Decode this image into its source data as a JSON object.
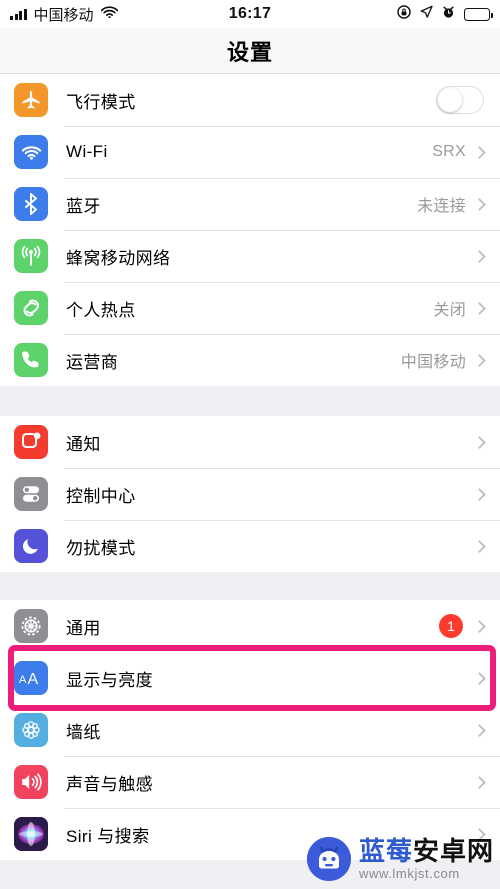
{
  "status_bar": {
    "carrier": "中国移动",
    "time": "16:17",
    "icons": [
      "signal-bars-icon",
      "wifi-icon",
      "rotation-lock-icon",
      "location-arrow-icon",
      "alarm-clock-icon",
      "battery-icon"
    ]
  },
  "nav": {
    "title": "设置"
  },
  "groups": [
    {
      "rows": [
        {
          "name": "airplane-mode",
          "icon": "airplane-icon",
          "color": "#F3972B",
          "label": "飞行模式",
          "control": "toggle",
          "toggle_on": false
        },
        {
          "name": "wifi",
          "icon": "wifi-icon",
          "color": "#3C7DEB",
          "label": "Wi-Fi",
          "value": "SRX",
          "control": "chevron"
        },
        {
          "name": "bluetooth",
          "icon": "bluetooth-icon",
          "color": "#3C7DEB",
          "label": "蓝牙",
          "value": "未连接",
          "control": "chevron"
        },
        {
          "name": "cellular",
          "icon": "cellular-antenna-icon",
          "color": "#5FD36B",
          "label": "蜂窝移动网络",
          "value": "",
          "control": "chevron"
        },
        {
          "name": "personal-hotspot",
          "icon": "hotspot-link-icon",
          "color": "#5FD36B",
          "label": "个人热点",
          "value": "关闭",
          "control": "chevron"
        },
        {
          "name": "carrier",
          "icon": "phone-icon",
          "color": "#5FD36B",
          "label": "运营商",
          "value": "中国移动",
          "control": "chevron"
        }
      ]
    },
    {
      "rows": [
        {
          "name": "notifications",
          "icon": "notification-square-icon",
          "color": "#F43C2E",
          "label": "通知",
          "value": "",
          "control": "chevron"
        },
        {
          "name": "control-center",
          "icon": "control-toggles-icon",
          "color": "#8E8E93",
          "label": "控制中心",
          "value": "",
          "control": "chevron"
        },
        {
          "name": "do-not-disturb",
          "icon": "moon-icon",
          "color": "#5452D6",
          "label": "勿扰模式",
          "value": "",
          "control": "chevron"
        }
      ]
    },
    {
      "rows": [
        {
          "name": "general",
          "icon": "gear-icon",
          "color": "#8E8E93",
          "label": "通用",
          "badge": "1",
          "control": "chevron"
        },
        {
          "name": "display-and-brightness",
          "icon": "aa-text-icon",
          "color": "#3C7DEB",
          "label": "显示与亮度",
          "value": "",
          "control": "chevron",
          "highlighted": true
        },
        {
          "name": "wallpaper",
          "icon": "flower-wallpaper-icon",
          "color": "#55AEE0",
          "label": "墙纸",
          "value": "",
          "control": "chevron"
        },
        {
          "name": "sounds-and-haptics",
          "icon": "speaker-icon",
          "color": "#F2435E",
          "label": "声音与触感",
          "value": "",
          "control": "chevron"
        },
        {
          "name": "siri-and-search",
          "icon": "siri-orb-icon",
          "color": "#2B1B4A",
          "label": "Siri 与搜索",
          "value": "",
          "control": "chevron"
        }
      ]
    }
  ],
  "highlight": {
    "color": "#ED1E79"
  },
  "watermark": {
    "brand_blue": "蓝莓",
    "brand_black": "安卓网",
    "url": "www.lmkjst.com"
  }
}
